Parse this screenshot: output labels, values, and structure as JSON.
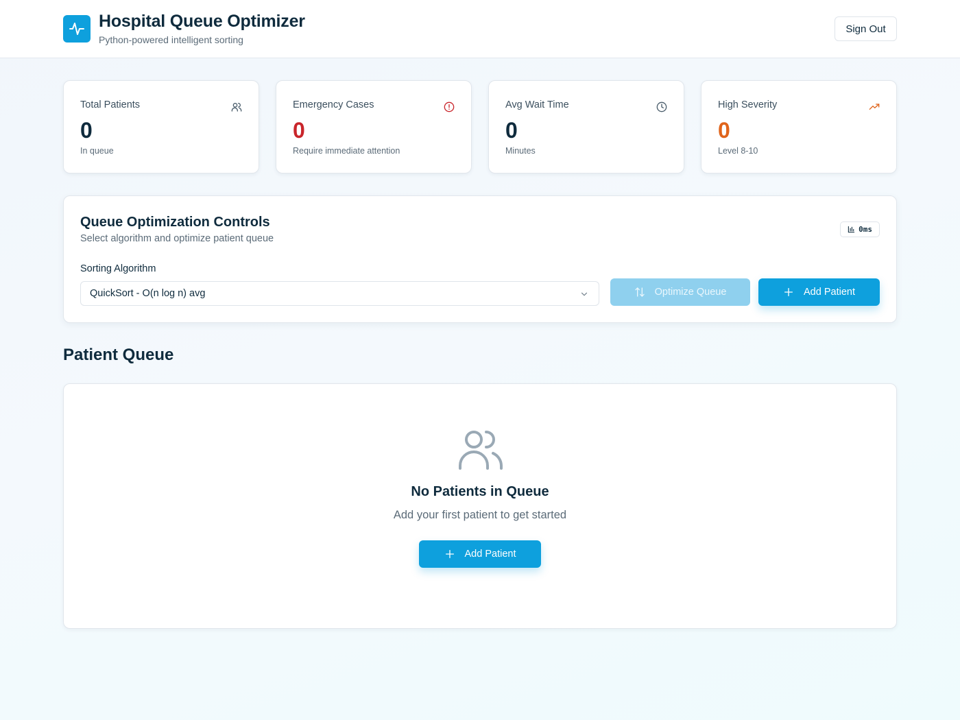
{
  "header": {
    "title": "Hospital Queue Optimizer",
    "subtitle": "Python-powered intelligent sorting",
    "logo_icon": "activity-icon",
    "sign_out_label": "Sign Out"
  },
  "stats": [
    {
      "label": "Total Patients",
      "value": "0",
      "note": "In queue",
      "icon": "users-icon",
      "color": "#0f2b3d"
    },
    {
      "label": "Emergency Cases",
      "value": "0",
      "note": "Require immediate attention",
      "icon": "alert-circle-icon",
      "color": "#c9252b"
    },
    {
      "label": "Avg Wait Time",
      "value": "0",
      "note": "Minutes",
      "icon": "clock-icon",
      "color": "#0f2b3d"
    },
    {
      "label": "High Severity",
      "value": "0",
      "note": "Level 8-10",
      "icon": "trending-up-icon",
      "color": "#e0641b"
    }
  ],
  "controls": {
    "title": "Queue Optimization Controls",
    "subtitle": "Select algorithm and optimize patient queue",
    "timing_badge": "0ms",
    "algorithm_label": "Sorting Algorithm",
    "algorithm_selected": "QuickSort - O(n log n) avg",
    "optimize_label": "Optimize Queue",
    "add_patient_label": "Add Patient"
  },
  "queue": {
    "title": "Patient Queue",
    "empty_title": "No Patients in Queue",
    "empty_subtitle": "Add your first patient to get started",
    "add_patient_label": "Add Patient"
  },
  "colors": {
    "accent": "#0ea0dd",
    "accent_disabled": "#8fd0ee",
    "emergency": "#c9252b",
    "severity": "#e0641b"
  }
}
